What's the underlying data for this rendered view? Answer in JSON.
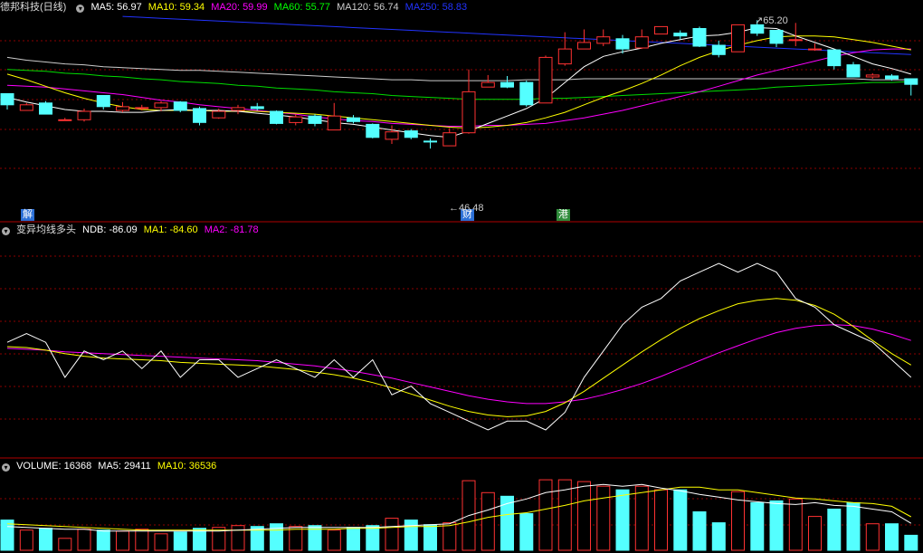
{
  "title": "德邦科技(日线)",
  "main_panel": {
    "legend": [
      {
        "label": "MA5: 56.97",
        "color": "#ffffff"
      },
      {
        "label": "MA10: 59.34",
        "color": "#ffff00"
      },
      {
        "label": "MA20: 59.99",
        "color": "#ff00ff"
      },
      {
        "label": "MA60: 55.77",
        "color": "#00ff00"
      },
      {
        "label": "MA120: 56.74",
        "color": "#cccccc"
      },
      {
        "label": "MA250: 58.83",
        "color": "#2233ff"
      }
    ],
    "high_label": "65.20",
    "low_label": "46.48",
    "event_tags": [
      {
        "text": "解",
        "color": "#2b6fd6"
      },
      {
        "text": "财",
        "color": "#2b6fd6"
      },
      {
        "text": "港",
        "color": "#2e8b3a"
      }
    ]
  },
  "indicator_panel": {
    "name": "变异均线多头",
    "legend": [
      {
        "label": "NDB: -86.09",
        "color": "#ffffff"
      },
      {
        "label": "MA1: -84.60",
        "color": "#ffff00"
      },
      {
        "label": "MA2: -81.78",
        "color": "#ff00ff"
      }
    ]
  },
  "volume_panel": {
    "legend": [
      {
        "label": "VOLUME: 16368",
        "color": "#ffffff"
      },
      {
        "label": "MA5: 29411",
        "color": "#ffffff"
      },
      {
        "label": "MA10: 36536",
        "color": "#ffff00"
      }
    ]
  },
  "colors": {
    "up": "#ff3232",
    "down": "#54ffff",
    "grid": "#8b0000"
  },
  "chart_data": {
    "type": "candlestick",
    "ylim": [
      45.5,
      66.5
    ],
    "candles": [
      [
        57.8,
        56.6,
        57.8,
        56.1
      ],
      [
        56.0,
        56.6,
        56.8,
        56.0
      ],
      [
        56.8,
        55.6,
        57.0,
        55.6
      ],
      [
        55.0,
        55.0,
        55.2,
        54.9
      ],
      [
        55.0,
        55.9,
        56.2,
        54.8
      ],
      [
        57.6,
        56.4,
        57.6,
        56.1
      ],
      [
        56.0,
        56.4,
        56.9,
        55.8
      ],
      [
        56.3,
        56.3,
        56.6,
        56.0
      ],
      [
        56.3,
        56.8,
        57.0,
        55.9
      ],
      [
        56.9,
        56.0,
        57.0,
        55.8
      ],
      [
        56.2,
        54.7,
        56.4,
        54.4
      ],
      [
        55.2,
        55.9,
        56.2,
        55.1
      ],
      [
        56.0,
        56.3,
        56.6,
        55.6
      ],
      [
        56.4,
        56.2,
        56.8,
        56.0
      ],
      [
        55.9,
        54.6,
        56.0,
        54.5
      ],
      [
        54.7,
        55.3,
        55.6,
        54.4
      ],
      [
        55.4,
        54.6,
        55.6,
        54.3
      ],
      [
        53.9,
        55.4,
        56.8,
        53.9
      ],
      [
        55.2,
        54.8,
        55.5,
        54.6
      ],
      [
        54.5,
        53.1,
        54.6,
        53.0
      ],
      [
        52.9,
        53.7,
        54.4,
        52.4
      ],
      [
        53.8,
        53.1,
        54.0,
        52.9
      ],
      [
        52.7,
        52.6,
        53.0,
        51.9
      ],
      [
        52.2,
        53.6,
        54.1,
        52.2
      ],
      [
        53.6,
        58.0,
        60.4,
        53.5
      ],
      [
        58.5,
        59.0,
        59.8,
        58.5
      ],
      [
        59.0,
        58.5,
        59.7,
        58.4
      ],
      [
        59.0,
        56.6,
        59.2,
        56.4
      ],
      [
        56.8,
        61.7,
        61.9,
        56.8
      ],
      [
        61.0,
        62.6,
        64.4,
        60.8
      ],
      [
        62.6,
        63.3,
        64.7,
        62.6
      ],
      [
        63.2,
        63.9,
        64.7,
        62.9
      ],
      [
        63.7,
        62.6,
        64.1,
        62.1
      ],
      [
        62.7,
        63.9,
        64.7,
        62.6
      ],
      [
        64.2,
        65.0,
        65.0,
        64.2
      ],
      [
        64.3,
        64.0,
        64.6,
        63.6
      ],
      [
        64.8,
        62.9,
        65.0,
        62.8
      ],
      [
        63.0,
        62.0,
        63.5,
        61.7
      ],
      [
        62.3,
        65.2,
        65.2,
        62.3
      ],
      [
        65.2,
        64.3,
        65.7,
        64.0
      ],
      [
        64.6,
        63.2,
        64.6,
        62.8
      ],
      [
        63.6,
        63.6,
        65.4,
        62.9
      ],
      [
        62.6,
        62.6,
        63.2,
        62.4
      ],
      [
        62.5,
        60.8,
        62.5,
        60.4
      ],
      [
        60.9,
        59.6,
        61.2,
        59.6
      ],
      [
        59.6,
        59.8,
        60.0,
        59.4
      ],
      [
        59.7,
        59.4,
        59.9,
        59.2
      ],
      [
        59.4,
        58.8,
        59.4,
        57.6
      ]
    ],
    "ma5": [
      57.4,
      56.9,
      56.5,
      56.1,
      55.9,
      55.9,
      55.8,
      55.8,
      56.0,
      56.1,
      56.0,
      56.0,
      55.9,
      55.7,
      55.5,
      55.3,
      55.0,
      54.7,
      54.5,
      54.2,
      53.9,
      53.6,
      53.3,
      53.1,
      53.8,
      54.6,
      55.4,
      56.2,
      57.3,
      59.0,
      60.7,
      61.8,
      62.3,
      62.7,
      63.2,
      63.6,
      64.0,
      64.1,
      64.4,
      64.9,
      64.8,
      64.0,
      63.3,
      62.6,
      61.8,
      61.0,
      60.5,
      59.9
    ],
    "ma10": [
      59.9,
      59.3,
      58.6,
      57.9,
      57.3,
      56.8,
      56.4,
      56.1,
      56.0,
      56.0,
      56.0,
      55.9,
      55.9,
      55.9,
      55.8,
      55.7,
      55.6,
      55.4,
      55.2,
      55.0,
      54.8,
      54.6,
      54.4,
      54.2,
      54.1,
      54.2,
      54.4,
      54.7,
      55.2,
      55.8,
      56.6,
      57.4,
      58.1,
      58.9,
      59.8,
      60.8,
      61.7,
      62.4,
      63.0,
      63.5,
      63.9,
      64.0,
      64.0,
      63.9,
      63.6,
      63.3,
      62.9,
      62.5
    ],
    "ma20": [
      58.7,
      58.6,
      58.5,
      58.3,
      58.1,
      57.9,
      57.7,
      57.4,
      57.1,
      56.9,
      56.6,
      56.4,
      56.2,
      56.0,
      55.8,
      55.6,
      55.3,
      55.1,
      54.9,
      54.8,
      54.6,
      54.5,
      54.4,
      54.3,
      54.3,
      54.4,
      54.4,
      54.5,
      54.6,
      54.9,
      55.2,
      55.6,
      56.0,
      56.5,
      57.0,
      57.5,
      58.0,
      58.6,
      59.2,
      59.8,
      60.3,
      60.8,
      61.3,
      61.8,
      62.2,
      62.5,
      62.6,
      62.6
    ],
    "ma60": [
      60.4,
      60.3,
      60.2,
      60.0,
      59.9,
      59.7,
      59.6,
      59.4,
      59.3,
      59.1,
      59.0,
      58.9,
      58.7,
      58.6,
      58.4,
      58.3,
      58.2,
      58.0,
      57.9,
      57.8,
      57.6,
      57.5,
      57.4,
      57.3,
      57.2,
      57.2,
      57.2,
      57.2,
      57.3,
      57.3,
      57.4,
      57.5,
      57.6,
      57.7,
      57.8,
      57.9,
      58.0,
      58.1,
      58.2,
      58.3,
      58.5,
      58.6,
      58.7,
      58.8,
      58.9,
      59.0,
      59.0,
      59.1
    ],
    "ma120": [
      61.7,
      61.4,
      61.2,
      61.0,
      60.9,
      60.7,
      60.6,
      60.5,
      60.4,
      60.3,
      60.3,
      60.2,
      60.1,
      60.0,
      59.9,
      59.8,
      59.7,
      59.6,
      59.5,
      59.4,
      59.3,
      59.3,
      59.2,
      59.2,
      59.2,
      59.2,
      59.2,
      59.3,
      59.3,
      59.3,
      59.4,
      59.4,
      59.4,
      59.4,
      59.4,
      59.4,
      59.4,
      59.4,
      59.4,
      59.4,
      59.4,
      59.4,
      59.4,
      59.4,
      59.4,
      59.3,
      59.3,
      59.3
    ],
    "ma250": [
      null,
      null,
      null,
      null,
      null,
      null,
      66.1,
      66.0,
      65.9,
      65.8,
      65.7,
      65.6,
      65.5,
      65.4,
      65.3,
      65.2,
      65.1,
      65.0,
      64.9,
      64.8,
      64.7,
      64.6,
      64.5,
      64.4,
      64.3,
      64.2,
      64.1,
      64.0,
      63.9,
      63.8,
      63.7,
      63.6,
      63.5,
      63.4,
      63.3,
      63.2,
      63.1,
      63.0,
      62.9,
      62.8,
      62.7,
      62.6,
      62.5,
      62.4,
      62.3,
      62.2,
      62.1,
      62.0
    ],
    "ndb": [
      -82,
      -81,
      -82,
      -86,
      -83,
      -84,
      -83,
      -85,
      -83,
      -86,
      -84,
      -84,
      -86,
      -85,
      -84,
      -85,
      -86,
      -84,
      -86,
      -84,
      -88,
      -87,
      -89,
      -90,
      -91,
      -92,
      -91,
      -91,
      -92,
      -90,
      -86,
      -83,
      -80,
      -78,
      -77,
      -75,
      -74,
      -73,
      -74,
      -73,
      -74,
      -77,
      -78,
      -80,
      -81,
      -82,
      -84,
      -86
    ],
    "ndb_ma1": [
      -82.5,
      -82.6,
      -82.9,
      -83.3,
      -83.6,
      -83.8,
      -83.9,
      -84.0,
      -84.1,
      -84.3,
      -84.4,
      -84.5,
      -84.6,
      -84.7,
      -84.9,
      -85.1,
      -85.4,
      -85.7,
      -86.1,
      -86.6,
      -87.2,
      -87.9,
      -88.6,
      -89.3,
      -89.9,
      -90.3,
      -90.5,
      -90.4,
      -89.9,
      -88.9,
      -87.6,
      -86.1,
      -84.6,
      -83.1,
      -81.7,
      -80.4,
      -79.3,
      -78.4,
      -77.6,
      -77.2,
      -77.0,
      -77.2,
      -77.8,
      -78.8,
      -80.2,
      -81.8,
      -83.3,
      -84.6
    ],
    "ndb_ma2": [
      -82.7,
      -82.8,
      -82.9,
      -83.1,
      -83.2,
      -83.3,
      -83.4,
      -83.5,
      -83.6,
      -83.7,
      -83.8,
      -83.9,
      -84.0,
      -84.1,
      -84.3,
      -84.5,
      -84.7,
      -85.0,
      -85.3,
      -85.7,
      -86.1,
      -86.6,
      -87.1,
      -87.6,
      -88.1,
      -88.5,
      -88.8,
      -89.0,
      -89.0,
      -88.8,
      -88.5,
      -88.0,
      -87.4,
      -86.7,
      -85.9,
      -85.0,
      -84.1,
      -83.2,
      -82.4,
      -81.6,
      -80.9,
      -80.4,
      -80.1,
      -80.0,
      -80.1,
      -80.5,
      -81.1,
      -81.8
    ],
    "volume": [
      33000,
      22000,
      24000,
      13000,
      23000,
      22000,
      21000,
      23000,
      18000,
      20000,
      24000,
      25000,
      27000,
      26000,
      29000,
      26000,
      27000,
      22000,
      25000,
      27000,
      35000,
      33000,
      28000,
      30000,
      76000,
      63000,
      59000,
      40000,
      77000,
      77000,
      75000,
      70000,
      66000,
      70000,
      66000,
      66000,
      42000,
      30000,
      64000,
      52000,
      54000,
      56000,
      37000,
      45000,
      52000,
      29000,
      29000,
      16368
    ],
    "vol_ma5": [
      26000,
      25000,
      24000,
      23000,
      23000,
      21000,
      21000,
      21000,
      21000,
      21000,
      21000,
      21000,
      22000,
      23000,
      24000,
      25000,
      25000,
      25000,
      25000,
      25000,
      26000,
      27000,
      28000,
      29000,
      38000,
      44000,
      51000,
      56000,
      63000,
      66000,
      70000,
      72000,
      70000,
      72000,
      68000,
      65000,
      61000,
      58000,
      55000,
      53000,
      51000,
      50000,
      52000,
      49000,
      48000,
      45000,
      42000,
      29411
    ],
    "vol_ma10": [
      29000,
      28000,
      27000,
      26000,
      25000,
      24000,
      23000,
      22000,
      22000,
      22000,
      22000,
      22000,
      22000,
      22000,
      22000,
      23000,
      23000,
      23000,
      24000,
      24000,
      25000,
      26000,
      26000,
      27000,
      31000,
      36000,
      39000,
      41000,
      45000,
      49000,
      54000,
      57000,
      60000,
      63000,
      66000,
      69000,
      69000,
      66000,
      66000,
      63000,
      60000,
      57000,
      56000,
      54000,
      52000,
      51000,
      48000,
      36536
    ],
    "ndb_ylim": [
      -95,
      -70
    ],
    "vol_ylim": [
      0,
      85000
    ]
  }
}
